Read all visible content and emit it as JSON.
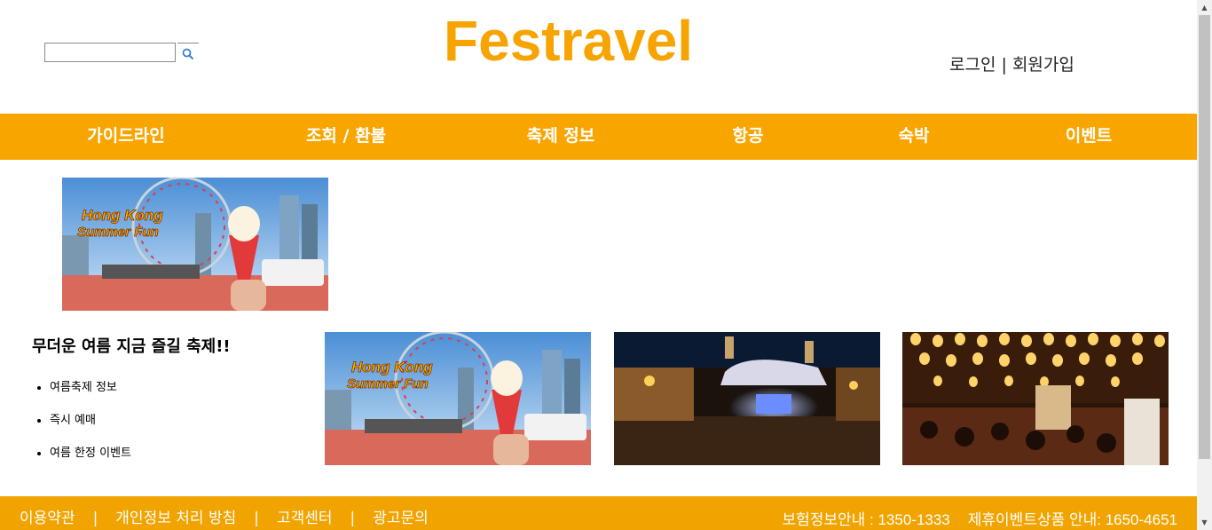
{
  "header": {
    "brand": "Festravel",
    "search": {
      "value": "",
      "icon": "search-icon"
    },
    "login_label": "로그인",
    "divider": "|",
    "signup_label": "회원가입"
  },
  "nav": {
    "items": [
      "가이드라인",
      "조회 / 환불",
      "축제 정보",
      "항공",
      "숙박",
      "이벤트"
    ]
  },
  "promo": {
    "banner_text": [
      "Hong Kong",
      "Summer Fun"
    ]
  },
  "section": {
    "title": "무더운 여름 지금 즐길 축제!!",
    "links": [
      "여름축제 정보",
      "즉시 예매",
      "여름 한정 이벤트"
    ]
  },
  "footer": {
    "links": [
      "이용약관",
      "개인정보 처리 방침",
      "고객센터",
      "광고문의"
    ],
    "separator": "|",
    "insurance": "보험정보안내 : 1350-1333",
    "partner": "제휴이벤트상품 안내: 1650-4651"
  },
  "colors": {
    "brand": "#f7a300",
    "nav_bg": "#f9a500",
    "footer_bg": "#f1a400"
  }
}
